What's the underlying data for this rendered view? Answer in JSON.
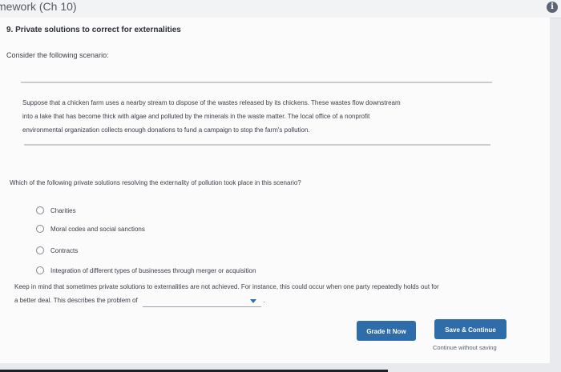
{
  "header": {
    "title": "mework (Ch 10)",
    "info_icon": "info-icon"
  },
  "question": {
    "title": "9. Private solutions to correct for externalities",
    "intro": "Consider the following scenario:",
    "scenario_lines": [
      "Suppose that a chicken farm uses a nearby stream to dispose of the wastes released by its chickens. These wastes flow downstream",
      "into a lake that has become thick with algae and polluted by the minerals in the waste matter. The local office of a nonprofit",
      "environmental organization collects enough donations to fund a campaign to stop the farm's pollution."
    ],
    "prompt": "Which of the following private solutions resolving the externality of pollution took place in this scenario?",
    "options": [
      "Charities",
      "Moral codes and social sanctions",
      "Contracts",
      "Integration of different types of businesses through merger or acquisition"
    ]
  },
  "followup": {
    "line1": "Keep in mind that sometimes private solutions to externalities are not achieved. For instance, this could occur when one party repeatedly holds out for",
    "line2_prefix": "a better deal. This describes the problem of",
    "line2_suffix": ".",
    "dropdown_value": ""
  },
  "actions": {
    "grade_label": "Grade It Now",
    "save_label": "Save & Continue",
    "continue_label": "Continue without saving"
  }
}
